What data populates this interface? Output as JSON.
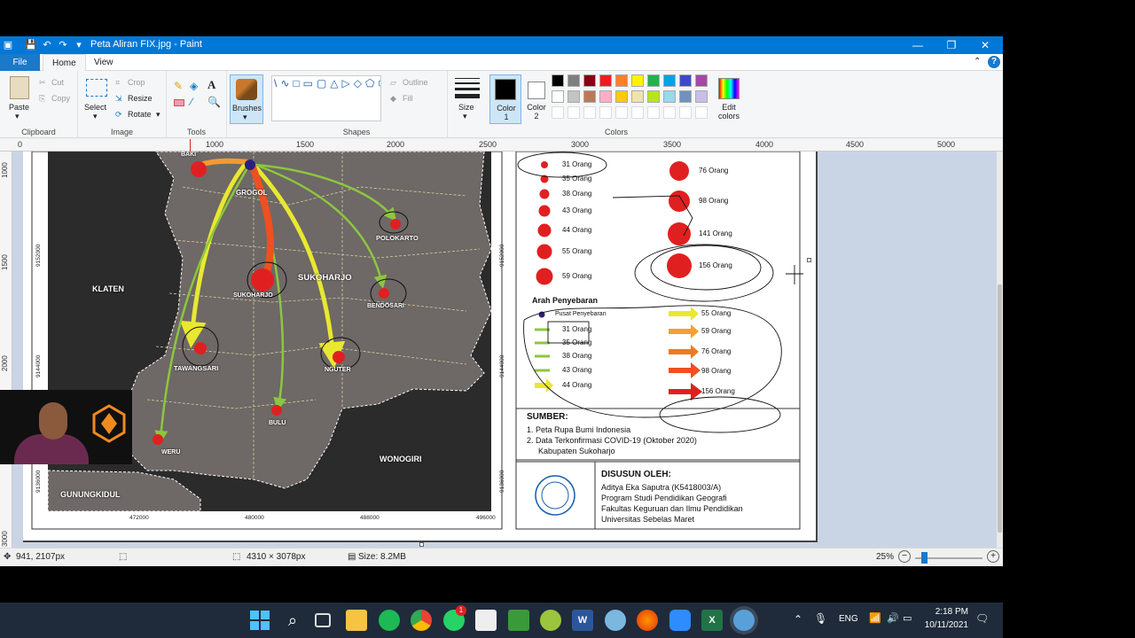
{
  "window": {
    "title": "Peta Aliran FIX.jpg - Paint"
  },
  "menu": {
    "file": "File",
    "home": "Home",
    "view": "View"
  },
  "ribbon": {
    "clipboard": {
      "paste": "Paste",
      "cut": "Cut",
      "copy": "Copy",
      "label": "Clipboard"
    },
    "image": {
      "select": "Select",
      "crop": "Crop",
      "resize": "Resize",
      "rotate": "Rotate",
      "label": "Image"
    },
    "tools": {
      "label": "Tools"
    },
    "brushes": "Brushes",
    "shapes": {
      "outline": "Outline",
      "fill": "Fill",
      "label": "Shapes"
    },
    "size": "Size",
    "color1": "Color 1",
    "color2": "Color 2",
    "edit_colors": "Edit colors",
    "colors_label": "Colors",
    "palette": [
      "#000000",
      "#7f7f7f",
      "#880015",
      "#ed1c24",
      "#ff7f27",
      "#fff200",
      "#22b14c",
      "#00a2e8",
      "#3f48cc",
      "#a349a4",
      "#ffffff",
      "#c3c3c3",
      "#b97a57",
      "#ffaec9",
      "#ffc90e",
      "#efe4b0",
      "#b5e61d",
      "#99d9ea",
      "#7092be",
      "#c8bfe7"
    ]
  },
  "ruler": {
    "h": [
      "0",
      "1000",
      "1500",
      "2000",
      "2500",
      "3000",
      "3500",
      "4000",
      "4500",
      "5000"
    ],
    "v": [
      "1000",
      "1500",
      "2000",
      "3000"
    ]
  },
  "map": {
    "places": [
      "BAKI",
      "GROGOL",
      "POLOKARTO",
      "KLATEN",
      "SUKOHARJO",
      "SUKOHARJO",
      "BENDOSARI",
      "TAWANGSARI",
      "NGUTER",
      "BULU",
      "WERU",
      "WONOGIRI",
      "GUNUNGKIDUL"
    ],
    "xticks": [
      "472000",
      "480000",
      "488000",
      "496000"
    ],
    "yticks": [
      "9152000",
      "9144000",
      "9136000"
    ]
  },
  "legend": {
    "circles_left": [
      "31 Orang",
      "35 Orang",
      "38 Orang",
      "43 Orang",
      "44 Orang",
      "55 Orang",
      "59 Orang"
    ],
    "circles_right": [
      "76 Orang",
      "98 Orang",
      "141 Orang",
      "156 Orang"
    ],
    "arah_title": "Arah Penyebaran",
    "pusat": "Pusat Penyebaran",
    "arrows_left": [
      "31 Orang",
      "35 Orang",
      "38 Orang",
      "43 Orang",
      "44 Orang"
    ],
    "arrows_right": [
      "55 Orang",
      "59 Orang",
      "76 Orang",
      "98 Orang",
      "156 Orang"
    ],
    "sumber_title": "SUMBER:",
    "sumber_lines": [
      "1. Peta Rupa Bumi Indonesia",
      "2. Data Terkonfirmasi COVID-19 (Oktober 2020)",
      "Kabupaten Sukoharjo"
    ],
    "disusun_title": "DISUSUN OLEH:",
    "disusun_lines": [
      "Aditya Eka Saputra (K5418003/A)",
      "Program Studi Pendidikan Geografi",
      "Fakultas Keguruan dan Ilmu Pendidikan",
      "Universitas Sebelas Maret"
    ]
  },
  "status": {
    "cursor": "941, 2107px",
    "dimensions": "4310 × 3078px",
    "size": "Size: 8.2MB",
    "zoom": "25%"
  },
  "taskbar": {
    "lang": "ENG",
    "time": "2:18 PM",
    "date": "10/11/2021",
    "badge": "1"
  }
}
